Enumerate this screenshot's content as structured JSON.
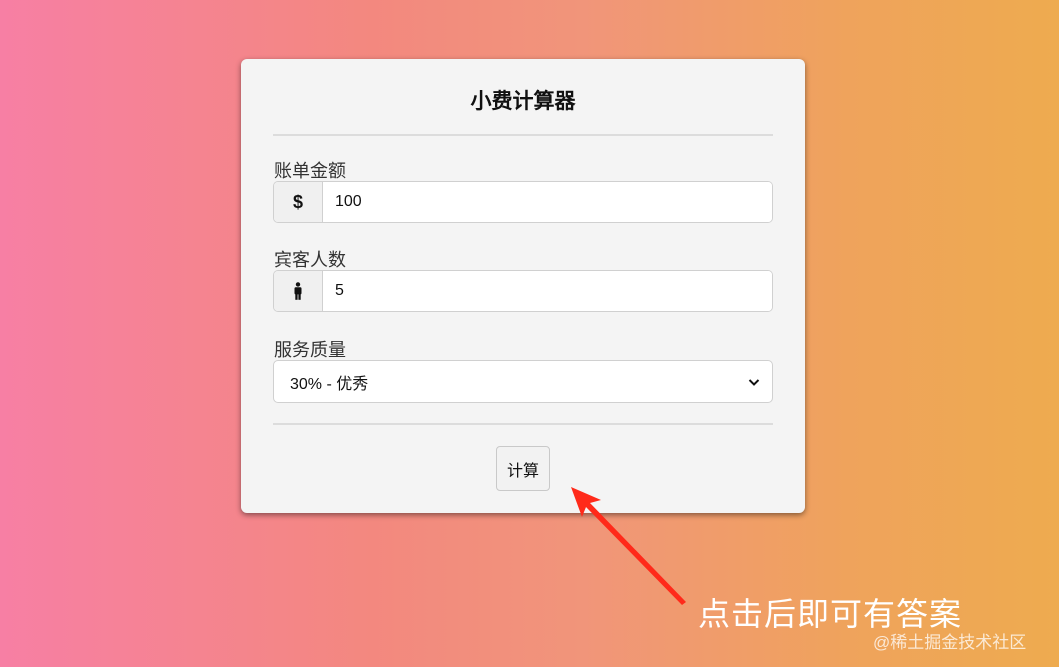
{
  "app": {
    "title": "小费计算器"
  },
  "form": {
    "bill": {
      "label": "账单金额",
      "icon": "dollar-icon",
      "symbol": "$",
      "value": "100"
    },
    "guests": {
      "label": "宾客人数",
      "icon": "person-icon",
      "value": "5"
    },
    "service": {
      "label": "服务质量",
      "selected": "30% - 优秀"
    },
    "calculate_label": "计算"
  },
  "annotation": {
    "text": "点击后即可有答案",
    "color": "#ff2a1a"
  },
  "watermark": "@稀土掘金技术社区",
  "colors": {
    "background_start": "#f77fa4",
    "background_end": "#eeab4f",
    "card": "#f4f4f4",
    "arrow": "#ff2a1a"
  }
}
